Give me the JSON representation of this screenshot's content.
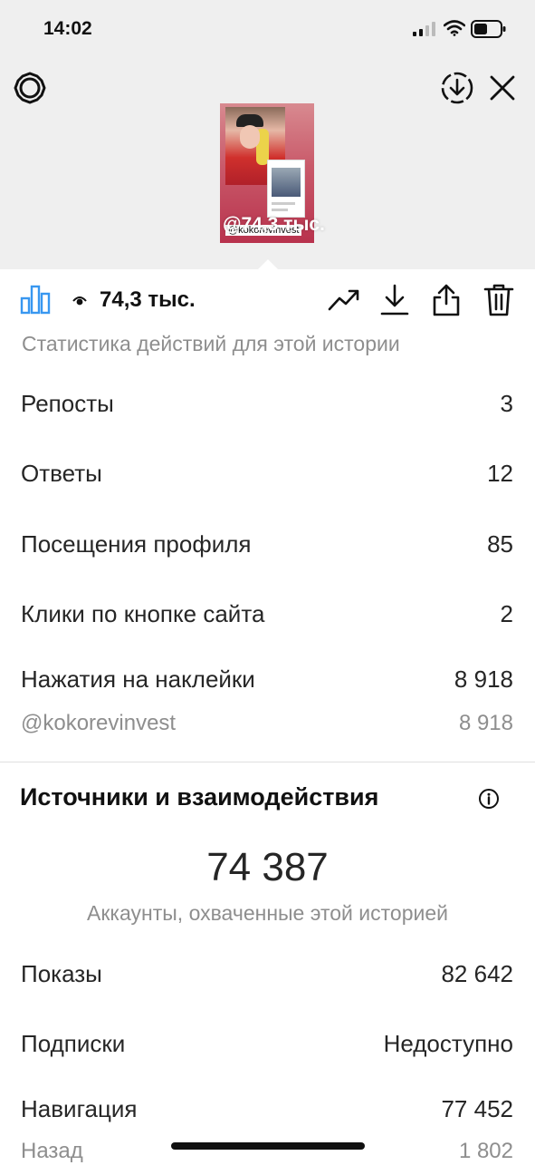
{
  "status": {
    "time": "14:02"
  },
  "preview": {
    "username_tag": "@kokorevinvest",
    "overlay_views": "@74,3 тыс."
  },
  "toolbar": {
    "views": "74,3 тыс."
  },
  "stats": {
    "subtitle": "Статистика действий для этой истории",
    "rows": [
      {
        "label": "Репосты",
        "value": "3"
      },
      {
        "label": "Ответы",
        "value": "12"
      },
      {
        "label": "Посещения профиля",
        "value": "85"
      },
      {
        "label": "Клики по кнопке сайта",
        "value": "2"
      },
      {
        "label": "Нажатия на наклейки",
        "value": "8 918"
      },
      {
        "label": "@kokorevinvest",
        "value": "8 918"
      }
    ]
  },
  "discovery": {
    "title": "Источники и взаимодействия",
    "reach_value": "74 387",
    "reach_caption": "Аккаунты, охваченные этой историей",
    "rows": [
      {
        "label": "Показы",
        "value": "82 642"
      },
      {
        "label": "Подписки",
        "value": "Недоступно"
      },
      {
        "label": "Навигация",
        "value": "77 452"
      },
      {
        "label": "Назад",
        "value": "1 802"
      }
    ]
  },
  "colors": {
    "accent_blue": "#3897f0",
    "text_primary": "#262626",
    "text_secondary": "#8e8e8e",
    "top_bg": "#efefef"
  },
  "icons": [
    "settings-gear-icon",
    "download-circle-icon",
    "close-icon",
    "insights-bars-icon",
    "eye-icon",
    "promote-trend-icon",
    "save-download-icon",
    "share-icon",
    "trash-icon",
    "info-icon"
  ]
}
